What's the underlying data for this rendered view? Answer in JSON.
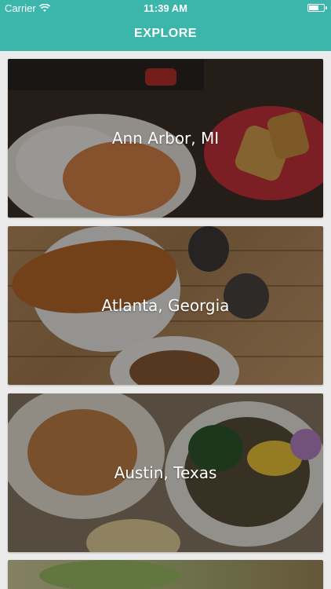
{
  "status_bar": {
    "carrier": "Carrier",
    "time": "11:39 AM"
  },
  "nav": {
    "title": "EXPLORE"
  },
  "cities": [
    {
      "name": "Ann Arbor, MI"
    },
    {
      "name": "Atlanta, Georgia"
    },
    {
      "name": "Austin, Texas"
    },
    {
      "name": ""
    }
  ],
  "colors": {
    "header": "#3cb6aa",
    "background": "#ebebeb",
    "overlay_text": "#ffffff"
  }
}
